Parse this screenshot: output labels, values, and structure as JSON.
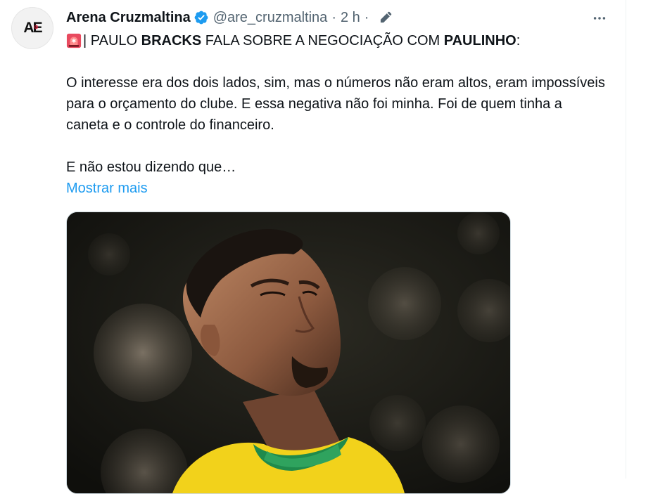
{
  "author": {
    "display_name": "Arena Cruzmaltina",
    "handle": "@are_cruzmaltina",
    "separator": "·",
    "time": "2 h",
    "avatar_text": "AE"
  },
  "post": {
    "line1": {
      "part1": "| PAULO ",
      "bold1": "BRACKS",
      "part2": " FALA SOBRE A NEGOCIAÇÃO COM ",
      "bold2": "PAULINHO",
      "part3": ":"
    },
    "paragraph1": "O interesse era dos dois lados, sim, mas o números não eram altos, eram impossíveis para o orçamento do clube. E essa negativa não foi minha. Foi de quem tinha a caneta e o controle do financeiro.",
    "paragraph2": "E não estou dizendo que…",
    "show_more": "Mostrar mais"
  },
  "icons": {
    "verified": "verified-badge-icon",
    "edit": "edit-pencil-icon",
    "more": "more-options-icon",
    "siren": "siren-emoji-icon"
  },
  "colors": {
    "link": "#1d9bf0",
    "secondary_text": "#536471",
    "verified": "#1d9bf0",
    "jersey_yellow": "#f2d21b",
    "collar_green": "#1f8a4c"
  }
}
